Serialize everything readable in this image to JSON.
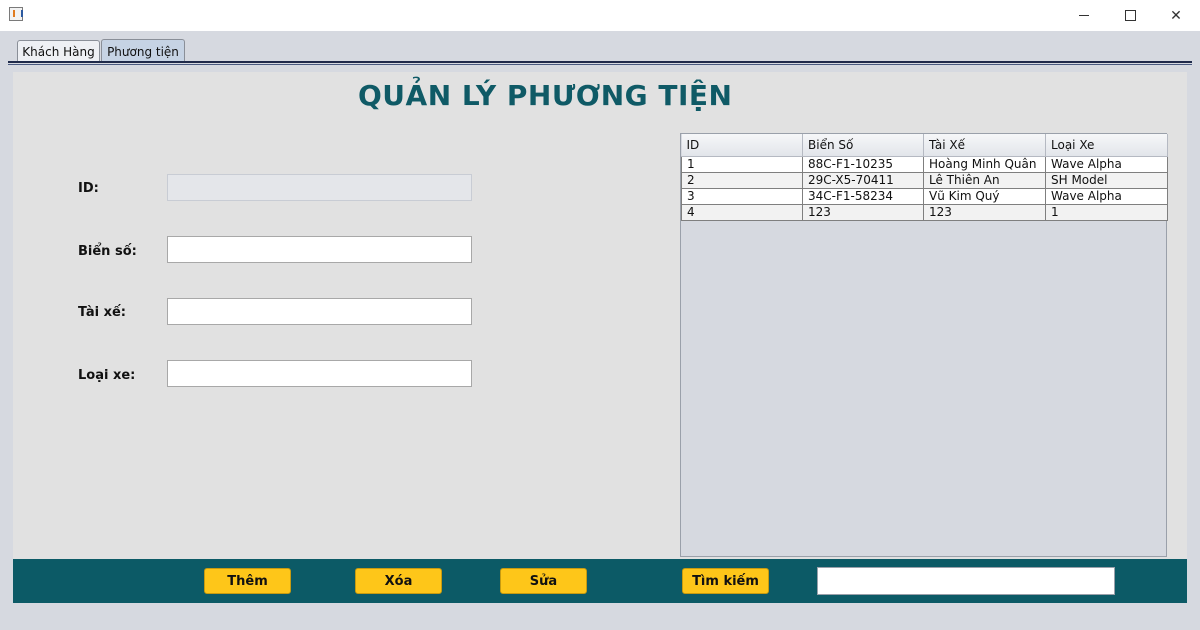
{
  "window": {
    "title": ""
  },
  "tabs": [
    {
      "label": "Khách Hàng"
    },
    {
      "label": "Phương tiện"
    }
  ],
  "heading": "QUẢN LÝ PHƯƠNG TIỆN",
  "form": {
    "id_label": "ID:",
    "id_value": "",
    "plate_label": "Biển số:",
    "plate_value": "",
    "driver_label": "Tài xế:",
    "driver_value": "",
    "type_label": "Loại xe:",
    "type_value": ""
  },
  "table": {
    "columns": [
      "ID",
      "Biển Số",
      "Tài Xế",
      "Loại Xe"
    ],
    "rows": [
      [
        "1",
        "88C-F1-10235",
        "Hoàng Minh Quân",
        "Wave Alpha"
      ],
      [
        "2",
        "29C-X5-70411",
        "Lê Thiên An",
        "SH Model"
      ],
      [
        "3",
        "34C-F1-58234",
        "Vũ Kim Quý",
        "Wave Alpha"
      ],
      [
        "4",
        "123",
        "123",
        "1"
      ]
    ]
  },
  "buttons": {
    "add": "Thêm",
    "delete": "Xóa",
    "edit": "Sửa",
    "search": "Tìm kiếm"
  },
  "search": {
    "value": ""
  },
  "colors": {
    "heading": "#0f5a66",
    "bottom_bar": "#0c5a66",
    "button": "#fec619",
    "panel": "#e1e1e1"
  },
  "icons": {
    "app": "java-app-icon",
    "minimize": "minimize-icon",
    "maximize": "maximize-icon",
    "close": "close-icon"
  }
}
